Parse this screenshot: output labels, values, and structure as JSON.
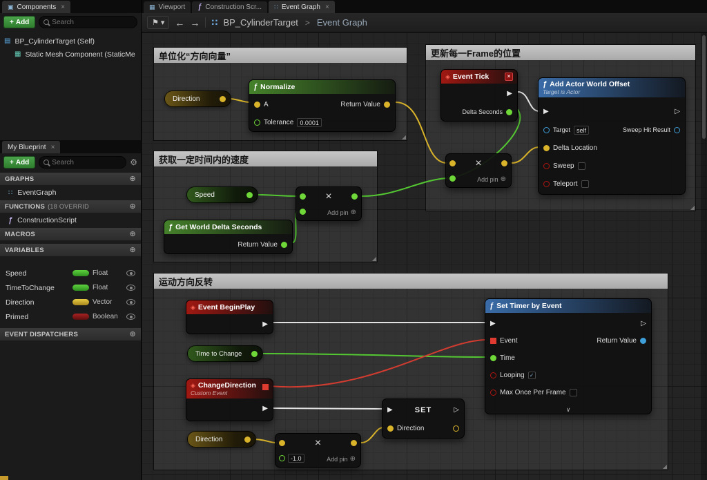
{
  "icons": {
    "close": "×",
    "plus": "+",
    "gear": "⚙",
    "bookmark": "⚑",
    "caret_down": "▾",
    "arrow_back": "←",
    "arrow_forward": "→",
    "add_circle": "⊕",
    "check": "✓",
    "event_diamond": "◈",
    "function_f": "ƒ",
    "exec_filled": "▶",
    "exec_hollow": "▷",
    "chevron_down": "∨",
    "tab_components": "▣",
    "tab_viewport": "▦",
    "tab_event_graph": "∷",
    "tree_blueprint": "▤",
    "tree_mesh": "▦",
    "graph_icon": "∷",
    "resize_handle": "◢"
  },
  "colors": {
    "exec_wire": "#e2e2e2",
    "vector": "#d9b32a",
    "float": "#6fd838",
    "boolean": "#b01510",
    "object": "#3f9fd8",
    "delegate": "#e03b30",
    "node_red": "#a01812",
    "node_green": "#45822b",
    "node_blue": "#3a6ca8",
    "add_button_green": "#2e7d2e",
    "comment_header": "#b8b8b8"
  },
  "tabs": {
    "components": "Components",
    "viewport": "Viewport",
    "construction": "Construction Scr...",
    "event_graph": "Event Graph",
    "my_blueprint": "My Blueprint"
  },
  "components_panel": {
    "add_button": "Add",
    "search_placeholder": "Search",
    "tree": [
      {
        "label": "BP_CylinderTarget (Self)"
      },
      {
        "label": "Static Mesh Component (StaticMe"
      }
    ]
  },
  "my_blueprint": {
    "add_button": "Add",
    "search_placeholder": "Search",
    "graphs_header": "GRAPHS",
    "functions_header": "FUNCTIONS",
    "functions_count": "(18 OVERRID",
    "macros_header": "MACROS",
    "variables_header": "VARIABLES",
    "event_dispatchers_header": "EVENT DISPATCHERS",
    "graph_items": [
      {
        "label": "EventGraph"
      }
    ],
    "function_items": [
      {
        "label": "ConstructionScript"
      }
    ],
    "variables": [
      {
        "name": "Speed",
        "type": "Float"
      },
      {
        "name": "TimeToChange",
        "type": "Float"
      },
      {
        "name": "Direction",
        "type": "Vector"
      },
      {
        "name": "Primed",
        "type": "Boolean"
      }
    ]
  },
  "toolbar": {
    "breadcrumb_parent": "BP_CylinderTarget",
    "breadcrumb_separator": ">",
    "breadcrumb_current": "Event Graph"
  },
  "graph": {
    "comments": [
      {
        "title": "单位化“方向向量”"
      },
      {
        "title": "更新每一Frame的位置"
      },
      {
        "title": "获取一定时间内的速度"
      },
      {
        "title": "运动方向反转"
      }
    ],
    "mul": {
      "symbol": "×",
      "add_pin": "Add pin"
    },
    "nodes": {
      "direction_get_1": {
        "label": "Direction"
      },
      "normalize": {
        "title": "Normalize",
        "pin_a": "A",
        "pin_tolerance": "Tolerance",
        "tolerance_value": "0.0001",
        "pin_return": "Return Value"
      },
      "event_tick": {
        "title": "Event Tick",
        "pin_delta_seconds": "Delta Seconds"
      },
      "add_actor_world_offset": {
        "title": "Add Actor World Offset",
        "subtitle": "Target is Actor",
        "pin_target": "Target",
        "target_value": "self",
        "pin_sweep_hit_result": "Sweep Hit Result",
        "pin_delta_location": "Delta Location",
        "pin_sweep": "Sweep",
        "pin_teleport": "Teleport"
      },
      "speed_get": {
        "label": "Speed"
      },
      "get_world_delta_seconds": {
        "title": "Get World Delta Seconds",
        "pin_return": "Return Value"
      },
      "event_beginplay": {
        "title": "Event BeginPlay"
      },
      "time_to_change_get": {
        "label": "Time to Change"
      },
      "change_direction": {
        "title": "ChangeDirection",
        "subtitle": "Custom Event"
      },
      "direction_get_2": {
        "label": "Direction"
      },
      "multiply_invert": {
        "value": "-1.0"
      },
      "set_direction": {
        "title": "SET",
        "pin_direction": "Direction"
      },
      "set_timer_by_event": {
        "title": "Set Timer by Event",
        "pin_event": "Event",
        "pin_return": "Return Value",
        "pin_time": "Time",
        "pin_looping": "Looping",
        "pin_max_once": "Max Once Per Frame"
      }
    }
  }
}
